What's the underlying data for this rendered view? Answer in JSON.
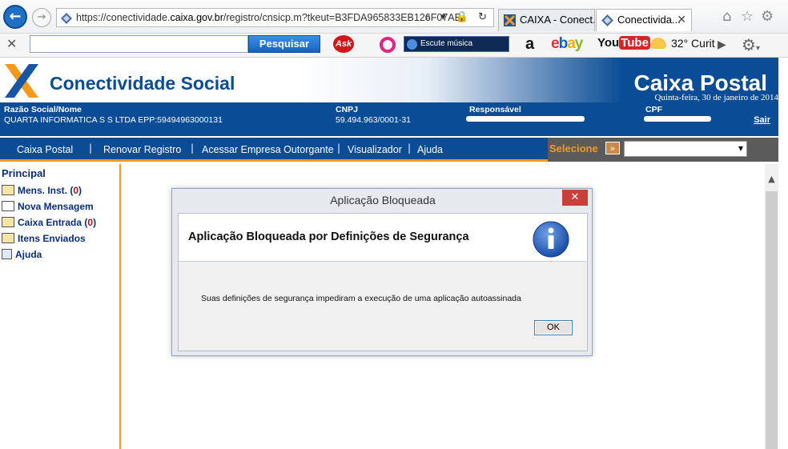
{
  "browser": {
    "url_prefix": "https://conectividade.",
    "url_domain": "caixa.gov.br",
    "url_suffix": "/registro/cnsicp.m?tkeut=B3FDA965833EB126F07AB",
    "tabs": [
      {
        "label": "CAIXA - Conect...",
        "active": false
      },
      {
        "label": "Conectivida...",
        "active": true
      }
    ],
    "toolbar": {
      "search_button": "Pesquisar",
      "ask_label": "Ask",
      "music_label": "Escute música",
      "amazon_label": "a",
      "ebay": {
        "e": "e",
        "b": "b",
        "a": "a",
        "y": "y"
      },
      "youtube_you": "You",
      "youtube_tube": "Tube",
      "weather": "32° Curit"
    }
  },
  "header": {
    "brand": "Conectividade Social",
    "section": "Caixa Postal",
    "date": "Quinta-feira, 30 de janeiro de 2014"
  },
  "info": {
    "razao_label": "Razão Social/Nome",
    "razao_value": "QUARTA INFORMATICA S S LTDA EPP:59494963000131",
    "cnpj_label": "CNPJ",
    "cnpj_value": "59.494.963/0001-31",
    "responsavel_label": "Responsável",
    "cpf_label": "CPF",
    "sair": "Sair"
  },
  "nav": {
    "items": [
      "Caixa Postal",
      "Renovar Registro",
      "Acessar Empresa Outorgante",
      "Visualizador",
      "Ajuda"
    ],
    "separator": "|",
    "selecione": "Selecione"
  },
  "sidebar": {
    "title": "Principal",
    "items": [
      {
        "label": "Mens. Inst. (",
        "count": "0",
        "close": ")"
      },
      {
        "label": "Nova Mensagem"
      },
      {
        "label": "Caixa Entrada (",
        "count": "0",
        "close": ")"
      },
      {
        "label": "Itens Enviados"
      },
      {
        "label": "Ajuda"
      }
    ]
  },
  "dialog": {
    "title": "Aplicação Bloqueada",
    "heading": "Aplicação Bloqueada por Definições de Segurança",
    "message": "Suas definições de segurança impediram a execução de uma aplicação autoassinada",
    "ok": "OK"
  },
  "colors": {
    "brand_blue": "#0a4c95",
    "accent_orange": "#f39a1c"
  }
}
